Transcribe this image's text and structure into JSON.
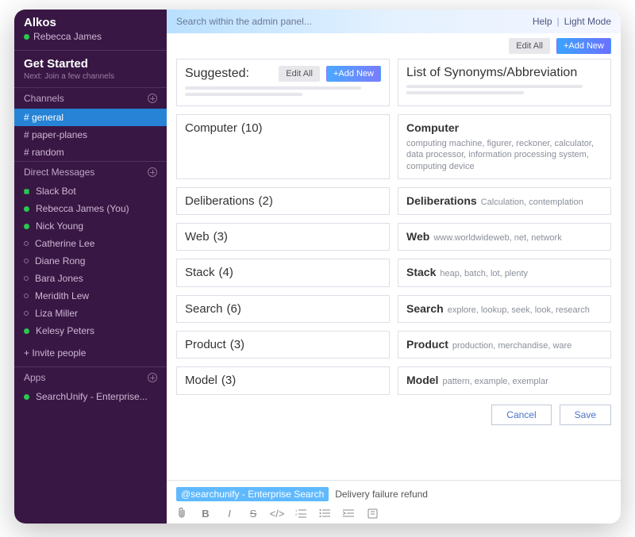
{
  "workspace": {
    "name": "Alkos",
    "user": "Rebecca James"
  },
  "get_started": {
    "title": "Get Started",
    "sub": "Next: Join a few channels"
  },
  "channels": {
    "label": "Channels",
    "items": [
      "# general",
      "# paper-planes",
      "# random"
    ],
    "active_index": 0
  },
  "dm": {
    "label": "Direct Messages",
    "items": [
      {
        "name": "Slack Bot",
        "status": "heart"
      },
      {
        "name": "Rebecca James (You)",
        "status": "online"
      },
      {
        "name": "Nick Young",
        "status": "online"
      },
      {
        "name": "Catherine Lee",
        "status": "offline"
      },
      {
        "name": "Diane Rong",
        "status": "offline"
      },
      {
        "name": "Bara Jones",
        "status": "offline"
      },
      {
        "name": "Meridith Lew",
        "status": "offline"
      },
      {
        "name": "Liza Miller",
        "status": "offline"
      },
      {
        "name": "Kelesy Peters",
        "status": "online"
      }
    ]
  },
  "invite_label": "+  Invite people",
  "apps": {
    "label": "Apps",
    "items": [
      "SearchUnify - Enterprise..."
    ]
  },
  "topbar": {
    "search_placeholder": "Search within the admin panel...",
    "help": "Help",
    "mode": "Light Mode"
  },
  "header_buttons": {
    "edit_all": "Edit All",
    "add_new": "+Add New"
  },
  "suggested": {
    "title": "Suggested:",
    "edit_all": "Edit All",
    "add_new": "+Add New",
    "rows": [
      {
        "term": "Computer",
        "count": "(10)"
      },
      {
        "term": "Deliberations",
        "count": "(2)"
      },
      {
        "term": "Web",
        "count": "(3)"
      },
      {
        "term": "Stack",
        "count": "(4)"
      },
      {
        "term": "Search",
        "count": "(6)"
      },
      {
        "term": "Product",
        "count": "(3)"
      },
      {
        "term": "Model",
        "count": "(3)"
      }
    ]
  },
  "synonyms": {
    "title": "List of Synonyms/Abbreviation",
    "rows": [
      {
        "term": "Computer",
        "list": "computing machine, figurer, reckoner, calculator, data processor, information processing system, computing device"
      },
      {
        "term": "Deliberations",
        "list": "Calculation, contemplation"
      },
      {
        "term": "Web",
        "list": "www.worldwideweb, net, network"
      },
      {
        "term": "Stack",
        "list": "heap, batch, lot, plenty"
      },
      {
        "term": "Search",
        "list": "explore, lookup, seek, look, research"
      },
      {
        "term": "Product",
        "list": "production, merchandise, ware"
      },
      {
        "term": "Model",
        "list": "pattern, example, exemplar"
      }
    ]
  },
  "actions": {
    "cancel": "Cancel",
    "save": "Save"
  },
  "composer": {
    "mention": "@searchunify - Enterprise Search",
    "text": "Delivery failure refund"
  }
}
